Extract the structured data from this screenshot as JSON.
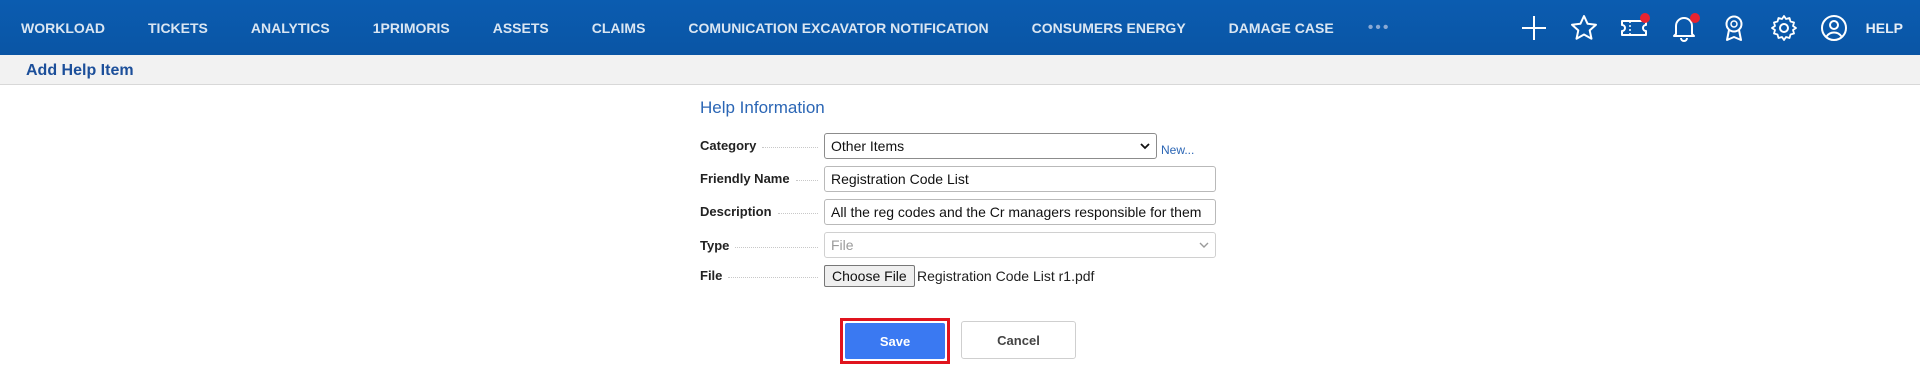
{
  "nav": {
    "items": [
      {
        "label": "WORKLOAD"
      },
      {
        "label": "TICKETS"
      },
      {
        "label": "ANALYTICS"
      },
      {
        "label": "1PRIMORIS"
      },
      {
        "label": "ASSETS"
      },
      {
        "label": "CLAIMS"
      },
      {
        "label": "COMUNICATION EXCAVATOR NOTIFICATION"
      },
      {
        "label": "CONSUMERS ENERGY"
      },
      {
        "label": "DAMAGE CASE"
      }
    ],
    "more": "•••",
    "help": "HELP",
    "icons": [
      "plus-icon",
      "star-icon",
      "ticket-icon",
      "bell-icon",
      "award-icon",
      "gear-icon",
      "user-icon"
    ]
  },
  "page": {
    "title": "Add Help Item"
  },
  "form": {
    "section_title": "Help Information",
    "category": {
      "label": "Category",
      "value": "Other Items",
      "new_link": "New..."
    },
    "friendly_name": {
      "label": "Friendly Name",
      "value": "Registration Code List"
    },
    "description": {
      "label": "Description",
      "value": "All the reg codes and the Cr managers responsible for them"
    },
    "type": {
      "label": "Type",
      "value": "File"
    },
    "file": {
      "label": "File",
      "button": "Choose File",
      "filename": "Registration Code List r1.pdf"
    }
  },
  "actions": {
    "save": "Save",
    "cancel": "Cancel"
  },
  "colors": {
    "nav_bg": "#0b5cb0",
    "accent": "#3a79f2",
    "highlight": "#e0141e",
    "notify": "#e8232f"
  }
}
